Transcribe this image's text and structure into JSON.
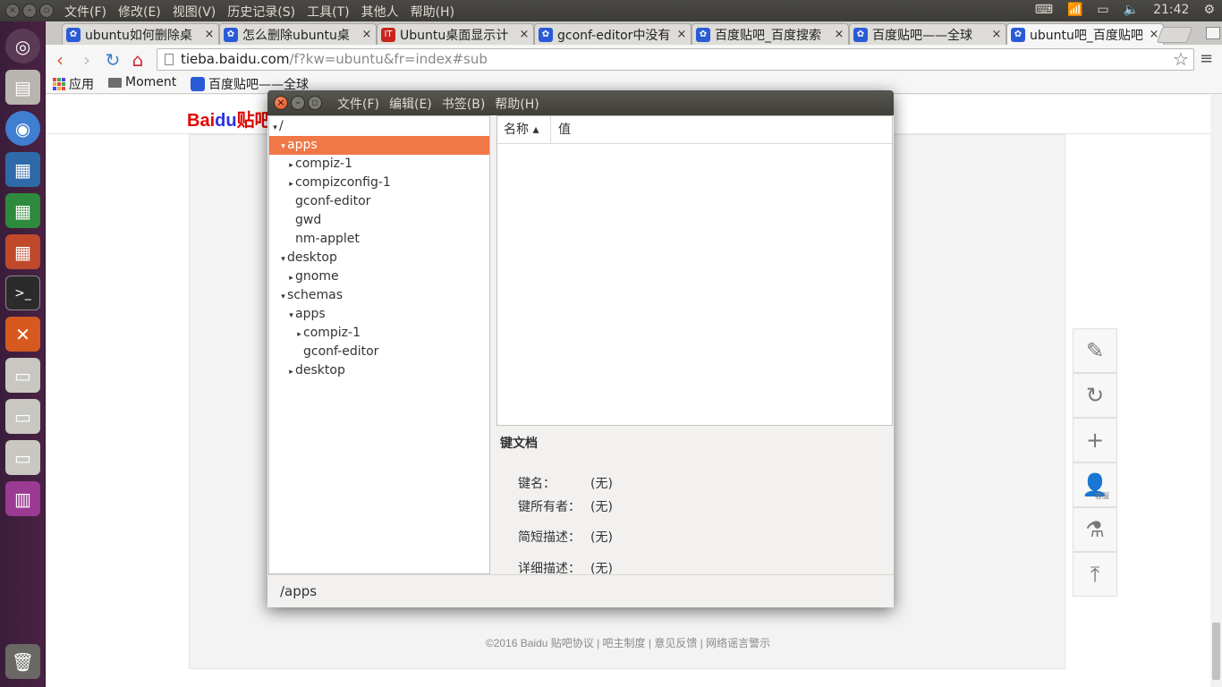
{
  "system": {
    "menus": [
      "文件(F)",
      "修改(E)",
      "视图(V)",
      "历史记录(S)",
      "工具(T)",
      "其他人",
      "帮助(H)"
    ],
    "clock": "21:42"
  },
  "browser": {
    "tabs": [
      {
        "title": "ubuntu如何删除桌"
      },
      {
        "title": "怎么删除ubuntu桌"
      },
      {
        "title": "Ubuntu桌面显示计"
      },
      {
        "title": "gconf-editor中没有"
      },
      {
        "title": "百度贴吧_百度搜索"
      },
      {
        "title": "百度贴吧——全球"
      },
      {
        "title": "ubuntu吧_百度贴吧"
      }
    ],
    "url_host": "tieba.baidu.com",
    "url_rest": "/f?kw=ubuntu&fr=index#sub",
    "bookmarks": {
      "apps": "应用",
      "moment": "Moment",
      "tieba": "百度贴吧——全球"
    }
  },
  "page": {
    "logo_bai": "Bai",
    "logo_du": "du",
    "logo_suffix": "贴吧",
    "footer": "©2016 Baidu 贴吧协议 | 吧主制度 | 意见反馈 | 网络谣言警示",
    "sidetool_label": "客服"
  },
  "dialog": {
    "menus": [
      "文件(F)",
      "编辑(E)",
      "书签(B)",
      "帮助(H)"
    ],
    "tree_root": "/",
    "tree": [
      {
        "label": "apps",
        "arrow": "▾",
        "selected": true
      },
      {
        "label": "compiz-1",
        "arrow": "▸"
      },
      {
        "label": "compizconfig-1",
        "arrow": "▸"
      },
      {
        "label": "gconf-editor",
        "arrow": ""
      },
      {
        "label": "gwd",
        "arrow": ""
      },
      {
        "label": "nm-applet",
        "arrow": ""
      },
      {
        "label": "desktop",
        "arrow": "▾"
      },
      {
        "label": "gnome",
        "arrow": "▸"
      },
      {
        "label": "schemas",
        "arrow": "▾"
      },
      {
        "label": "apps",
        "arrow": "▾"
      },
      {
        "label": "compiz-1",
        "arrow": "▸"
      },
      {
        "label": "gconf-editor",
        "arrow": ""
      },
      {
        "label": "desktop",
        "arrow": "▸"
      }
    ],
    "col_name": "名称 ▴",
    "col_value": "值",
    "doc_title": "键文档",
    "doc_rows": [
      {
        "key": "键名：",
        "value": "(无)"
      },
      {
        "key": "键所有者：",
        "value": "(无)"
      },
      {
        "key": "简短描述：",
        "value": "(无)"
      },
      {
        "key": "详细描述：",
        "value": "(无)"
      }
    ],
    "status_path": "/apps"
  },
  "colors": {
    "selection": "#f07746",
    "launcher": "#3a1d3b",
    "baidu_red": "#e10601",
    "baidu_blue": "#2932e1"
  }
}
